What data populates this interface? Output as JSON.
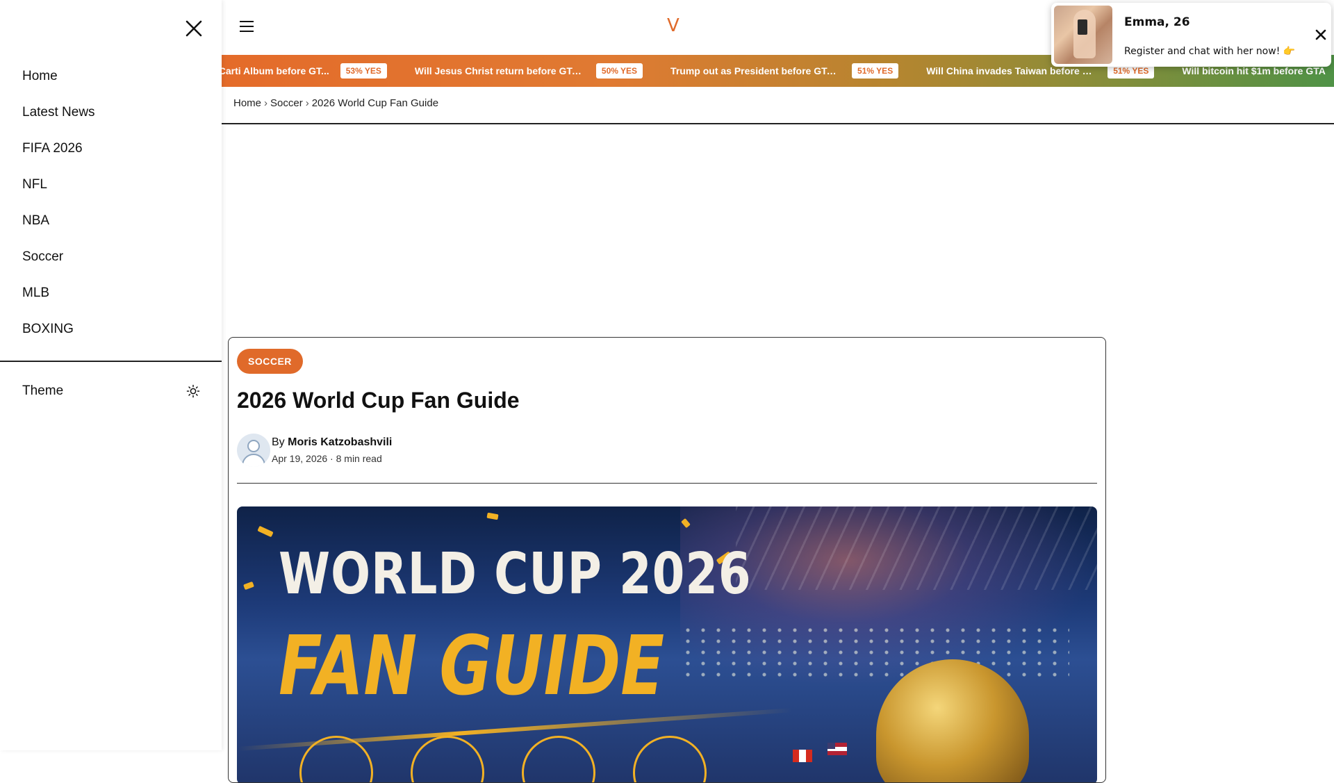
{
  "drawer": {
    "nav": [
      {
        "label": "Home"
      },
      {
        "label": "Latest News"
      },
      {
        "label": "FIFA 2026"
      },
      {
        "label": "NFL"
      },
      {
        "label": "NBA"
      },
      {
        "label": "Soccer"
      },
      {
        "label": "MLB"
      },
      {
        "label": "BOXING"
      }
    ],
    "theme_label": "Theme",
    "icons": {
      "close": "close-icon",
      "theme": "sun-icon"
    }
  },
  "header": {
    "logo": "V",
    "icons": {
      "menu": "hamburger-icon"
    }
  },
  "ticker": {
    "items": [
      {
        "text": "i Carti Album before GT...",
        "badge": "53% YES"
      },
      {
        "text": "Will Jesus Christ return before GTA ...",
        "badge": "50% YES"
      },
      {
        "text": "Trump out as President before GTA ...",
        "badge": "51% YES"
      },
      {
        "text": "Will China invades Taiwan before GT...",
        "badge": "51% YES"
      },
      {
        "text": "Will bitcoin hit $1m before GTA",
        "badge": ""
      }
    ]
  },
  "breadcrumb": {
    "home": "Home",
    "sep": "›",
    "section": "Soccer",
    "current": "2026 World Cup Fan Guide"
  },
  "popup": {
    "name": "Emma, 26",
    "message": "Register and chat with her now! 👉",
    "icons": {
      "close": "close-icon"
    }
  },
  "article": {
    "tag": "SOCCER",
    "title": "2026 World Cup Fan Guide",
    "by": "By",
    "author": "Moris Katzobashvili",
    "meta": "Apr 19, 2026 · 8 min read",
    "hero": {
      "line1": "WORLD CUP 2026",
      "line2": "FAN GUIDE"
    }
  },
  "colors": {
    "accent": "#e06a2a",
    "hero_yellow": "#f2b124"
  }
}
